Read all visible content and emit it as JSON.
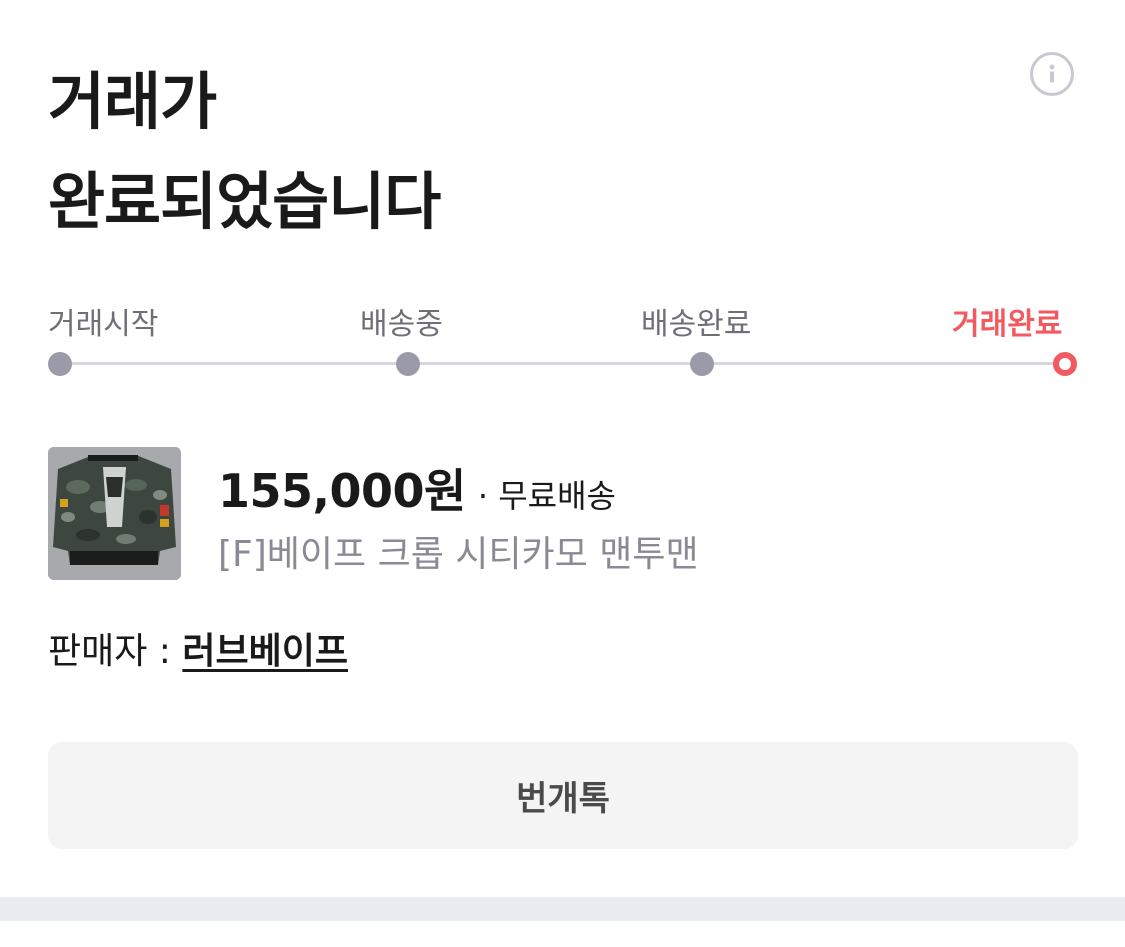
{
  "header": {
    "title_line1": "거래가",
    "title_line2": "완료되었습니다",
    "info_icon": "info-icon"
  },
  "progress": {
    "steps": [
      {
        "label": "거래시작",
        "state": "done"
      },
      {
        "label": "배송중",
        "state": "done"
      },
      {
        "label": "배송완료",
        "state": "done"
      },
      {
        "label": "거래완료",
        "state": "current"
      }
    ],
    "active_color": "#f25a5f",
    "inactive_color": "#9a9aa8"
  },
  "product": {
    "image_icon": "product-thumbnail-bape-camo-sweatshirt",
    "price": "155,000원",
    "shipping": "· 무료배송",
    "name": "[F]베이프 크롭 시티카모 맨투맨"
  },
  "seller": {
    "prefix": "판매자 : ",
    "name": "러브베이프"
  },
  "actions": {
    "chat_label": "번개톡"
  }
}
